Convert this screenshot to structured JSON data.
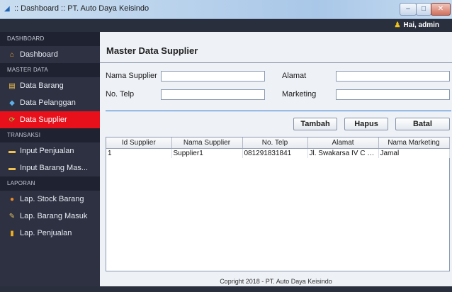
{
  "window": {
    "title": ":: Dashboard :: PT. Auto Daya Keisindo",
    "minimize": "–",
    "maximize": "□",
    "close": "✕"
  },
  "topbar": {
    "greeting": "Hai, admin",
    "user_icon": "user-icon"
  },
  "sidebar": {
    "sections": [
      {
        "header": "DASHBOARD",
        "items": [
          {
            "label": "Dashboard",
            "icon": "home-icon",
            "glyph": "⌂",
            "color": "#f0a030",
            "active": false
          }
        ]
      },
      {
        "header": "MASTER DATA",
        "items": [
          {
            "label": "Data Barang",
            "icon": "document-icon",
            "glyph": "▤",
            "color": "#f2c14e",
            "active": false
          },
          {
            "label": "Data Pelanggan",
            "icon": "customer-icon",
            "glyph": "◆",
            "color": "#5fb0e8",
            "active": false
          },
          {
            "label": "Data Supplier",
            "icon": "supplier-icon",
            "glyph": "⟳",
            "color": "#7ed957",
            "active": true
          }
        ]
      },
      {
        "header": "TRANSAKSI",
        "items": [
          {
            "label": "Input Penjualan",
            "icon": "folder-icon",
            "glyph": "▬",
            "color": "#f2c14e",
            "active": false
          },
          {
            "label": "Input Barang Mas...",
            "icon": "folder-icon",
            "glyph": "▬",
            "color": "#f2c14e",
            "active": false
          }
        ]
      },
      {
        "header": "LAPORAN",
        "items": [
          {
            "label": "Lap. Stock Barang",
            "icon": "pie-chart-icon",
            "glyph": "●",
            "color": "#f08a24",
            "active": false
          },
          {
            "label": "Lap. Barang Masuk",
            "icon": "tools-icon",
            "glyph": "✎",
            "color": "#e0c060",
            "active": false
          },
          {
            "label": "Lap. Penjualan",
            "icon": "bar-chart-icon",
            "glyph": "▮",
            "color": "#f0b020",
            "active": false
          }
        ]
      }
    ]
  },
  "main": {
    "title": "Master Data Supplier",
    "form": {
      "nama_supplier_label": "Nama Supplier",
      "nama_supplier_value": "",
      "no_telp_label": "No. Telp",
      "no_telp_value": "",
      "alamat_label": "Alamat",
      "alamat_value": "",
      "marketing_label": "Marketing",
      "marketing_value": ""
    },
    "buttons": {
      "tambah": "Tambah",
      "hapus": "Hapus",
      "batal": "Batal"
    },
    "table": {
      "columns": [
        "Id Supplier",
        "Nama Supplier",
        "No. Telp",
        "Alamat",
        "Nama Marketing"
      ],
      "rows": [
        [
          "1",
          "Supplier1",
          "081291831841",
          "Jl. Swakarsa IV C N...",
          "Jamal"
        ]
      ]
    },
    "footer": "Copright 2018 - PT. Auto Daya Keisindo"
  },
  "colors": {
    "sidebar_bg": "#2d3142",
    "active_item": "#e8101a",
    "accent_line": "#1f6fcf"
  }
}
